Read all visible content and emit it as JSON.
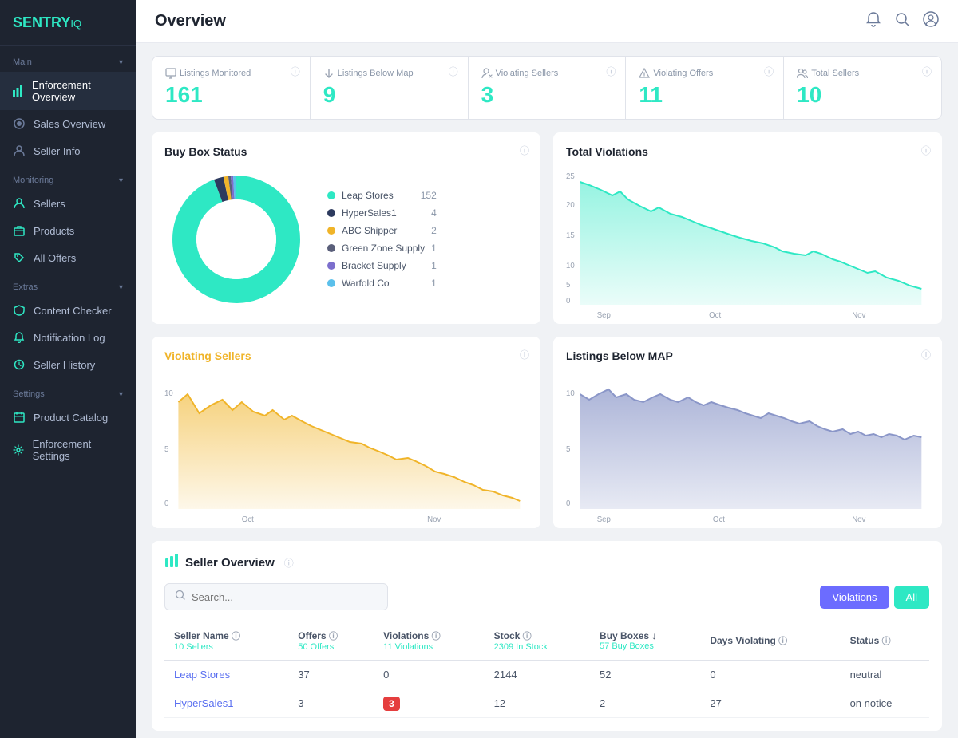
{
  "sidebar": {
    "logo": {
      "text": "SENTRY",
      "accent": "IQ"
    },
    "sections": [
      {
        "label": "Main",
        "items": [
          {
            "id": "enforcement-overview",
            "label": "Enforcement Overview",
            "icon": "bar-chart",
            "active": true
          },
          {
            "id": "sales-overview",
            "label": "Sales Overview",
            "icon": "tag"
          },
          {
            "id": "seller-info",
            "label": "Seller Info",
            "icon": "user"
          }
        ]
      },
      {
        "label": "Monitoring",
        "items": [
          {
            "id": "sellers",
            "label": "Sellers",
            "icon": "person"
          },
          {
            "id": "products",
            "label": "Products",
            "icon": "box"
          },
          {
            "id": "all-offers",
            "label": "All Offers",
            "icon": "tag2"
          }
        ]
      },
      {
        "label": "Extras",
        "items": [
          {
            "id": "content-checker",
            "label": "Content Checker",
            "icon": "shield"
          },
          {
            "id": "notification-log",
            "label": "Notification Log",
            "icon": "bell"
          },
          {
            "id": "seller-history",
            "label": "Seller History",
            "icon": "clock"
          }
        ]
      },
      {
        "label": "Settings",
        "items": [
          {
            "id": "product-catalog",
            "label": "Product Catalog",
            "icon": "calendar"
          },
          {
            "id": "enforcement-settings",
            "label": "Enforcement Settings",
            "icon": "gear"
          }
        ]
      }
    ]
  },
  "topbar": {
    "title": "Overview"
  },
  "stats": [
    {
      "id": "listings-monitored",
      "label": "Listings Monitored",
      "value": "161",
      "icon": "monitor"
    },
    {
      "id": "listings-below-map",
      "label": "Listings Below Map",
      "value": "9",
      "icon": "arrow-down"
    },
    {
      "id": "violating-sellers",
      "label": "Violating Sellers",
      "value": "3",
      "icon": "user-x"
    },
    {
      "id": "violating-offers",
      "label": "Violating Offers",
      "value": "11",
      "icon": "alert"
    },
    {
      "id": "total-sellers",
      "label": "Total Sellers",
      "value": "10",
      "icon": "users"
    }
  ],
  "buybox": {
    "title": "Buy Box Status",
    "legend": [
      {
        "name": "Leap Stores",
        "color": "#2ee8c4",
        "count": 152
      },
      {
        "name": "HyperSales1",
        "color": "#2d3a5e",
        "count": 4
      },
      {
        "name": "ABC Shipper",
        "color": "#f0b429",
        "count": 2
      },
      {
        "name": "Green Zone Supply",
        "color": "#5a5f7a",
        "count": 1
      },
      {
        "name": "Bracket Supply",
        "color": "#7c6fcd",
        "count": 1
      },
      {
        "name": "Warfold Co",
        "color": "#5bc0eb",
        "count": 1
      }
    ]
  },
  "total_violations": {
    "title": "Total Violations",
    "x_labels": [
      "Sep",
      "Oct",
      "Nov"
    ],
    "y_max": 25
  },
  "violating_sellers": {
    "title": "Violating Sellers",
    "x_labels": [
      "Oct",
      "Nov"
    ],
    "y_labels": [
      "0",
      "5",
      "10"
    ],
    "y_max": 10
  },
  "listings_below_map": {
    "title": "Listings Below MAP",
    "x_labels": [
      "Sep",
      "Oct",
      "Nov"
    ],
    "y_labels": [
      "0",
      "5",
      "10"
    ],
    "y_max": 10
  },
  "seller_overview": {
    "title": "Seller Overview",
    "search_placeholder": "Search...",
    "filter_violations": "Violations",
    "filter_all": "All",
    "columns": [
      {
        "label": "Seller Name",
        "sub": "10 Sellers"
      },
      {
        "label": "Offers",
        "sub": "50 Offers"
      },
      {
        "label": "Violations",
        "sub": "11 Violations"
      },
      {
        "label": "Stock",
        "sub": "2309 In Stock"
      },
      {
        "label": "Buy Boxes",
        "sub": "57 Buy Boxes"
      },
      {
        "label": "Days Violating",
        "sub": ""
      },
      {
        "label": "Status",
        "sub": ""
      }
    ],
    "rows": [
      {
        "name": "Leap Stores",
        "offers": 37,
        "violations": 0,
        "violations_badge": false,
        "stock": 2144,
        "buy_boxes": 52,
        "days_violating": 0,
        "status": "neutral"
      },
      {
        "name": "HyperSales1",
        "offers": 3,
        "violations": 3,
        "violations_badge": true,
        "stock": 12,
        "buy_boxes": 2,
        "days_violating": 27,
        "status": "on notice"
      }
    ]
  }
}
